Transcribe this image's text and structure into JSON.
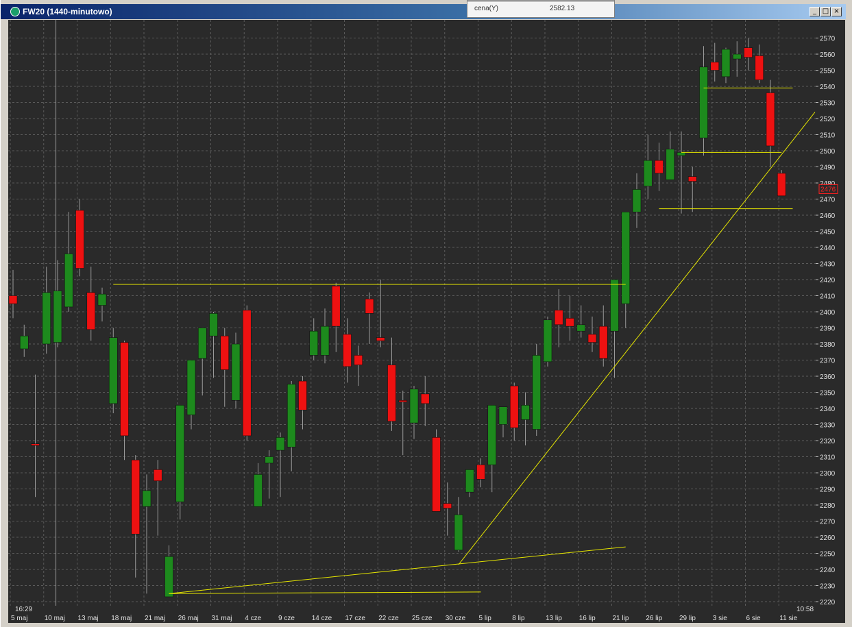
{
  "window": {
    "title": "FW20 (1440-minutowo)",
    "icon": "chart-app-icon",
    "buttons": {
      "minimize": "_",
      "maximize": "□",
      "close": "×"
    }
  },
  "info_panel": {
    "label": "cena(Y)",
    "value": "2582.13"
  },
  "colors": {
    "background": "#2a2a2a",
    "bull": "#1d8a1d",
    "bear": "#ee1111",
    "trendline": "#e6e600",
    "grid": "#5a5a5a",
    "price_marker": "#ff2020"
  },
  "chart_data": {
    "type": "candlestick",
    "instrument": "FW20",
    "interval": "1440-minutowo",
    "ylim": [
      2220,
      2575
    ],
    "y_ticks": [
      2220,
      2230,
      2240,
      2250,
      2260,
      2270,
      2280,
      2290,
      2300,
      2310,
      2320,
      2330,
      2340,
      2350,
      2360,
      2370,
      2380,
      2390,
      2400,
      2410,
      2420,
      2430,
      2440,
      2450,
      2460,
      2470,
      2480,
      2490,
      2500,
      2510,
      2520,
      2530,
      2540,
      2550,
      2560,
      2570
    ],
    "x_labels": [
      "5 maj",
      "10 maj",
      "13 maj",
      "18 maj",
      "21 maj",
      "26 maj",
      "31 maj",
      "4 cze",
      "9 cze",
      "14 cze",
      "17 cze",
      "22 cze",
      "25 cze",
      "30 cze",
      "5 lip",
      "8 lip",
      "13 lip",
      "16 lip",
      "21 lip",
      "26 lip",
      "29 lip",
      "3 sie",
      "6 sie",
      "11 sie"
    ],
    "x_label_index": [
      0,
      3,
      6,
      9,
      12,
      15,
      18,
      21,
      24,
      27,
      30,
      33,
      36,
      39,
      42,
      45,
      48,
      51,
      54,
      57,
      60,
      63,
      66,
      69
    ],
    "time_start_label": "16:29",
    "time_end_label": "10:58",
    "current_price_label": "2476",
    "current_price": 2476,
    "candles": [
      [
        2410,
        2426,
        2396,
        2405
      ],
      [
        2377,
        2392,
        2372,
        2385
      ],
      [
        2318,
        2361,
        2285,
        2317
      ],
      [
        2380,
        2428,
        2374,
        2412
      ],
      [
        2381,
        2432,
        2378,
        2413
      ],
      [
        2403,
        2462,
        2400,
        2436
      ],
      [
        2463,
        2470,
        2422,
        2427
      ],
      [
        2412,
        2428,
        2382,
        2389
      ],
      [
        2404,
        2415,
        2394,
        2411
      ],
      [
        2343,
        2390,
        2337,
        2384
      ],
      [
        2381,
        2382,
        2308,
        2323
      ],
      [
        2308,
        2311,
        2235,
        2262
      ],
      [
        2279,
        2299,
        2225,
        2289
      ],
      [
        2302,
        2308,
        2261,
        2295
      ],
      [
        2223,
        2255,
        2223,
        2248
      ],
      [
        2282,
        2342,
        2271,
        2342
      ],
      [
        2336,
        2370,
        2327,
        2370
      ],
      [
        2371,
        2390,
        2348,
        2390
      ],
      [
        2385,
        2400,
        2359,
        2399
      ],
      [
        2385,
        2390,
        2341,
        2364
      ],
      [
        2345,
        2387,
        2340,
        2380
      ],
      [
        2401,
        2404,
        2320,
        2323
      ],
      [
        2279,
        2306,
        2279,
        2299
      ],
      [
        2306,
        2314,
        2284,
        2310
      ],
      [
        2314,
        2325,
        2285,
        2322
      ],
      [
        2316,
        2357,
        2301,
        2355
      ],
      [
        2357,
        2360,
        2327,
        2339
      ],
      [
        2373,
        2396,
        2370,
        2388
      ],
      [
        2373,
        2402,
        2368,
        2391
      ],
      [
        2416,
        2418,
        2375,
        2391
      ],
      [
        2386,
        2396,
        2356,
        2366
      ],
      [
        2373,
        2379,
        2354,
        2367
      ],
      [
        2408,
        2412,
        2380,
        2399
      ],
      [
        2384,
        2420,
        2378,
        2382
      ],
      [
        2367,
        2384,
        2326,
        2332
      ],
      [
        2345,
        2351,
        2311,
        2344
      ],
      [
        2331,
        2354,
        2321,
        2352
      ],
      [
        2349,
        2360,
        2329,
        2343
      ],
      [
        2322,
        2327,
        2276,
        2276
      ],
      [
        2281,
        2294,
        2261,
        2278
      ],
      [
        2252,
        2285,
        2251,
        2274
      ],
      [
        2288,
        2301,
        2285,
        2302
      ],
      [
        2305,
        2309,
        2291,
        2296
      ],
      [
        2305,
        2342,
        2288,
        2342
      ],
      [
        2330,
        2340,
        2322,
        2341
      ],
      [
        2354,
        2356,
        2320,
        2328
      ],
      [
        2333,
        2350,
        2317,
        2342
      ],
      [
        2327,
        2380,
        2323,
        2373
      ],
      [
        2369,
        2397,
        2366,
        2395
      ],
      [
        2401,
        2414,
        2378,
        2392
      ],
      [
        2396,
        2410,
        2382,
        2391
      ],
      [
        2388,
        2404,
        2384,
        2392
      ],
      [
        2386,
        2397,
        2375,
        2381
      ],
      [
        2391,
        2404,
        2366,
        2371
      ],
      [
        2388,
        2420,
        2359,
        2420
      ],
      [
        2405,
        2421,
        2390,
        2462
      ],
      [
        2462,
        2486,
        2452,
        2476
      ],
      [
        2478,
        2510,
        2470,
        2494
      ],
      [
        2494,
        2505,
        2475,
        2486
      ],
      [
        2482,
        2512,
        2482,
        2501
      ],
      [
        2497,
        2512,
        2461,
        2499
      ],
      [
        2484,
        2490,
        2462,
        2481
      ],
      [
        2508,
        2565,
        2497,
        2552
      ],
      [
        2555,
        2567,
        2543,
        2550
      ],
      [
        2546,
        2564,
        2542,
        2563
      ],
      [
        2557,
        2568,
        2546,
        2560
      ],
      [
        2564,
        2570,
        2550,
        2558
      ],
      [
        2559,
        2566,
        2542,
        2544
      ],
      [
        2536,
        2544,
        2490,
        2503
      ],
      [
        2486,
        2488,
        2473,
        2472
      ]
    ],
    "trendlines": [
      {
        "from": [
          14,
          2225
        ],
        "to": [
          42,
          2226
        ]
      },
      {
        "from": [
          14,
          2225
        ],
        "to": [
          55,
          2254
        ]
      },
      {
        "from": [
          40,
          2243
        ],
        "to": [
          72,
          2524
        ]
      },
      {
        "from": [
          9,
          2417
        ],
        "to": [
          55,
          2417
        ]
      },
      {
        "from": [
          58,
          2464
        ],
        "to": [
          70,
          2464
        ]
      },
      {
        "from": [
          60,
          2499
        ],
        "to": [
          69,
          2499
        ]
      },
      {
        "from": [
          62,
          2539
        ],
        "to": [
          70,
          2539
        ]
      }
    ],
    "cursor_line_index": 3.85
  }
}
